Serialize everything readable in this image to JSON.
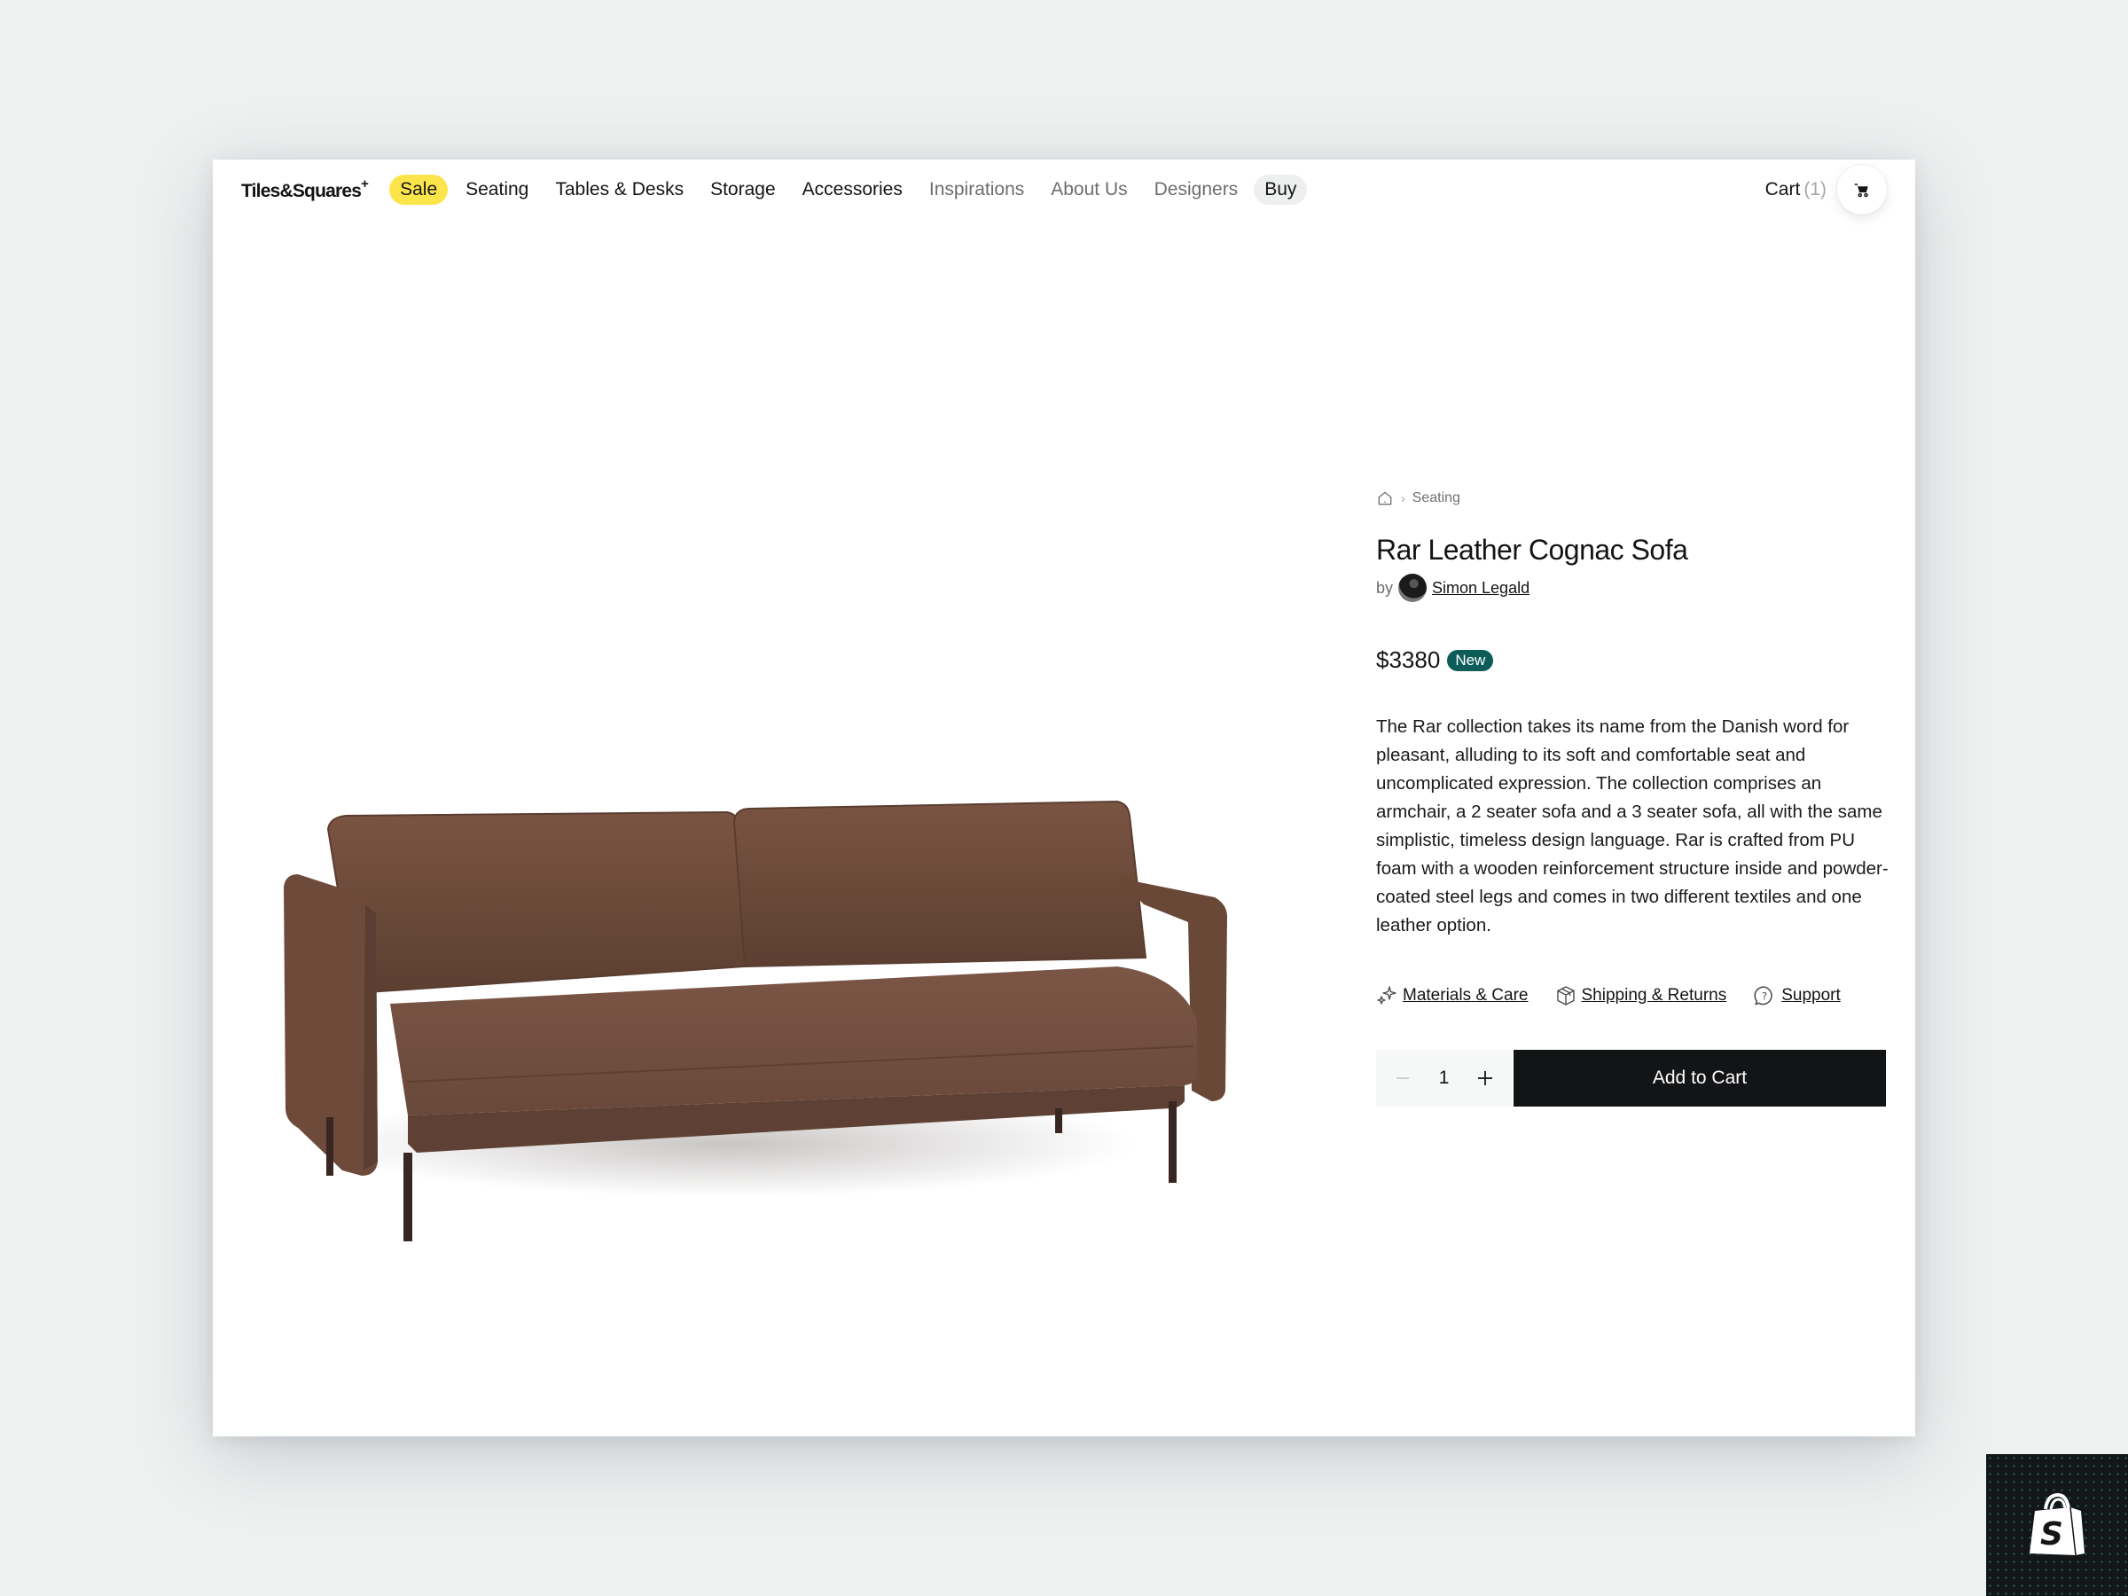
{
  "brand": {
    "name": "Tiles&Squares",
    "superscript": "+"
  },
  "nav": {
    "items": [
      {
        "label": "Sale",
        "style": "sale"
      },
      {
        "label": "Seating",
        "style": "default"
      },
      {
        "label": "Tables & Desks",
        "style": "default"
      },
      {
        "label": "Storage",
        "style": "default"
      },
      {
        "label": "Accessories",
        "style": "default"
      },
      {
        "label": "Inspirations",
        "style": "muted"
      },
      {
        "label": "About Us",
        "style": "muted"
      },
      {
        "label": "Designers",
        "style": "muted"
      },
      {
        "label": "Buy",
        "style": "active"
      }
    ],
    "cart_label": "Cart",
    "cart_count": "(1)",
    "cart_icon": "cart-icon"
  },
  "colors": {
    "sale_highlight": "#fbe54a",
    "badge_new": "#0d5c5a",
    "add_to_cart_bg": "#131416",
    "page_bg": "#eff1f1",
    "sofa_leather": "#6b4a3a"
  },
  "product": {
    "image_alt": "Brown leather 2-seater sofa with dark steel legs",
    "breadcrumb": {
      "home_icon": "home-icon",
      "items": [
        "Seating"
      ]
    },
    "title": "Rar Leather Cognac Sofa",
    "by_label": "by",
    "designer": "Simon Legald",
    "price": "$3380",
    "badge": "New",
    "description": "The Rar collection takes its name from the Danish word for pleasant, alluding to its soft and comfortable seat and uncomplicated expression. The collection comprises an armchair, a 2 seater sofa and a 3 seater sofa, all with the same simplistic, timeless design language. Rar is crafted from PU foam with a wooden reinforcement structure inside and powder-coated steel legs and comes in two different textiles and one leather option.",
    "links": [
      {
        "label": "Materials & Care",
        "icon": "sparkles-icon"
      },
      {
        "label": "Shipping & Returns",
        "icon": "box-icon"
      },
      {
        "label": "Support",
        "icon": "help-chat-icon"
      }
    ],
    "quantity": "1",
    "add_to_cart_label": "Add to Cart"
  },
  "corner_badge": {
    "icon": "shopify-bag-icon"
  }
}
